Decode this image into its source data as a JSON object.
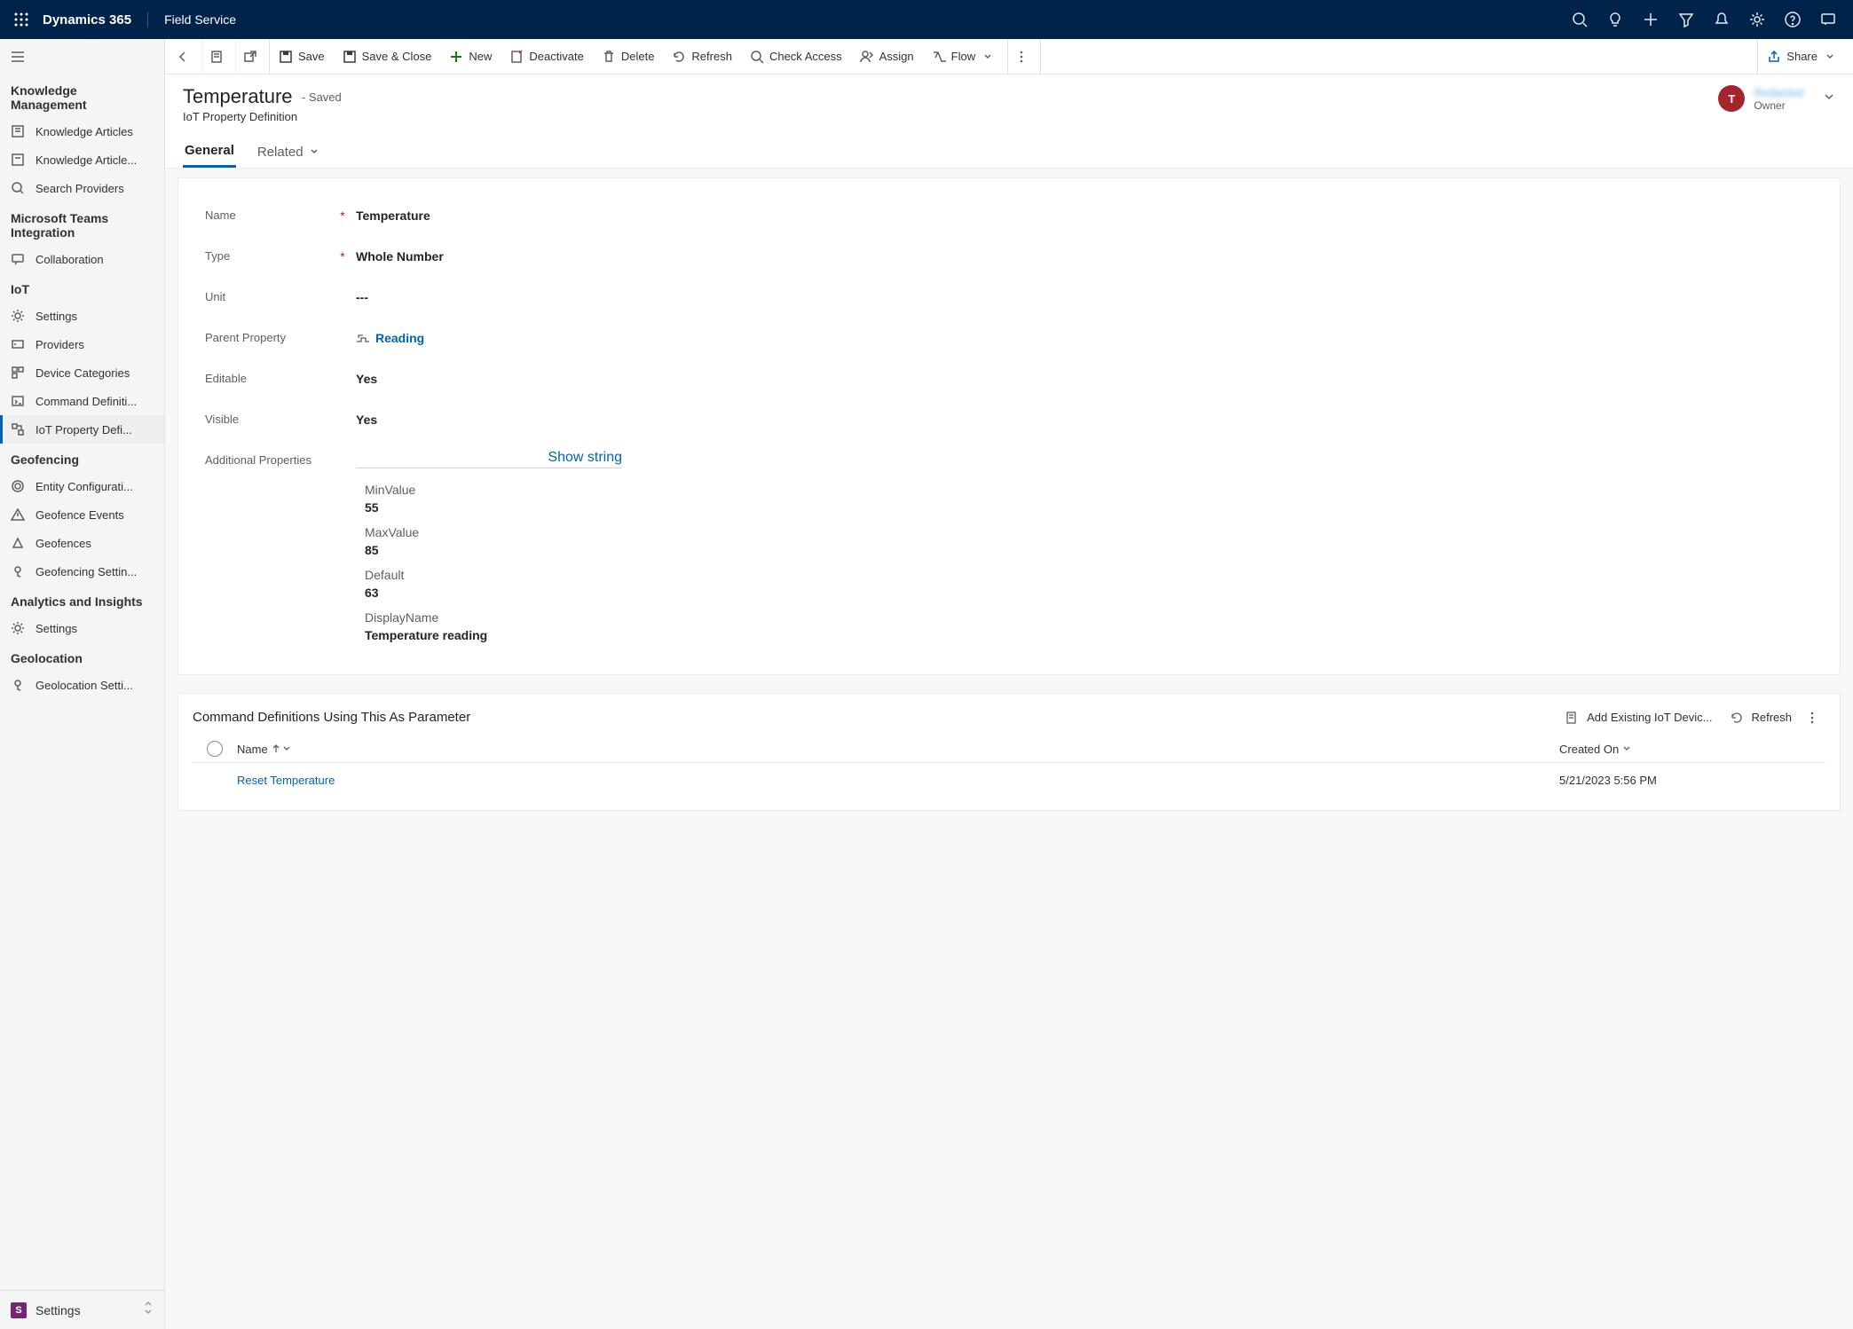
{
  "topbar": {
    "brand": "Dynamics 365",
    "module": "Field Service"
  },
  "area": {
    "letter": "S",
    "name": "Settings"
  },
  "sidebar": {
    "groups": [
      {
        "title": "Knowledge Management",
        "items": [
          {
            "label": "Knowledge Articles",
            "sel": false
          },
          {
            "label": "Knowledge Article...",
            "sel": false
          },
          {
            "label": "Search Providers",
            "sel": false
          }
        ]
      },
      {
        "title": "Microsoft Teams Integration",
        "items": [
          {
            "label": "Collaboration",
            "sel": false
          }
        ]
      },
      {
        "title": "IoT",
        "items": [
          {
            "label": "Settings",
            "sel": false
          },
          {
            "label": "Providers",
            "sel": false
          },
          {
            "label": "Device Categories",
            "sel": false
          },
          {
            "label": "Command Definiti...",
            "sel": false
          },
          {
            "label": "IoT Property Defi...",
            "sel": true
          }
        ]
      },
      {
        "title": "Geofencing",
        "items": [
          {
            "label": "Entity Configurati...",
            "sel": false
          },
          {
            "label": "Geofence Events",
            "sel": false
          },
          {
            "label": "Geofences",
            "sel": false
          },
          {
            "label": "Geofencing Settin...",
            "sel": false
          }
        ]
      },
      {
        "title": "Analytics and Insights",
        "items": [
          {
            "label": "Settings",
            "sel": false
          }
        ]
      },
      {
        "title": "Geolocation",
        "items": [
          {
            "label": "Geolocation Setti...",
            "sel": false
          }
        ]
      }
    ]
  },
  "cmdbar": {
    "save": "Save",
    "saveClose": "Save & Close",
    "new": "New",
    "deactivate": "Deactivate",
    "delete": "Delete",
    "refresh": "Refresh",
    "checkAccess": "Check Access",
    "assign": "Assign",
    "flow": "Flow",
    "share": "Share"
  },
  "record": {
    "title": "Temperature",
    "status": "- Saved",
    "entity": "IoT Property Definition",
    "ownerInitial": "T",
    "ownerName": "Redacted",
    "ownerLabel": "Owner"
  },
  "tabs": {
    "general": "General",
    "related": "Related"
  },
  "fields": {
    "nameLbl": "Name",
    "nameVal": "Temperature",
    "typeLbl": "Type",
    "typeVal": "Whole Number",
    "unitLbl": "Unit",
    "unitVal": "---",
    "parentLbl": "Parent Property",
    "parentVal": "Reading",
    "editLbl": "Editable",
    "editVal": "Yes",
    "visLbl": "Visible",
    "visVal": "Yes",
    "addLbl": "Additional Properties",
    "showString": "Show string",
    "minKey": "MinValue",
    "minVal": "55",
    "maxKey": "MaxValue",
    "maxVal": "85",
    "defKey": "Default",
    "defVal": "63",
    "dispKey": "DisplayName",
    "dispVal": "Temperature reading"
  },
  "subgrid": {
    "title": "Command Definitions Using This As Parameter",
    "addExisting": "Add Existing IoT Devic...",
    "refresh": "Refresh",
    "colName": "Name",
    "colCreated": "Created On",
    "rows": [
      {
        "name": "Reset Temperature",
        "created": "5/21/2023 5:56 PM"
      }
    ]
  }
}
